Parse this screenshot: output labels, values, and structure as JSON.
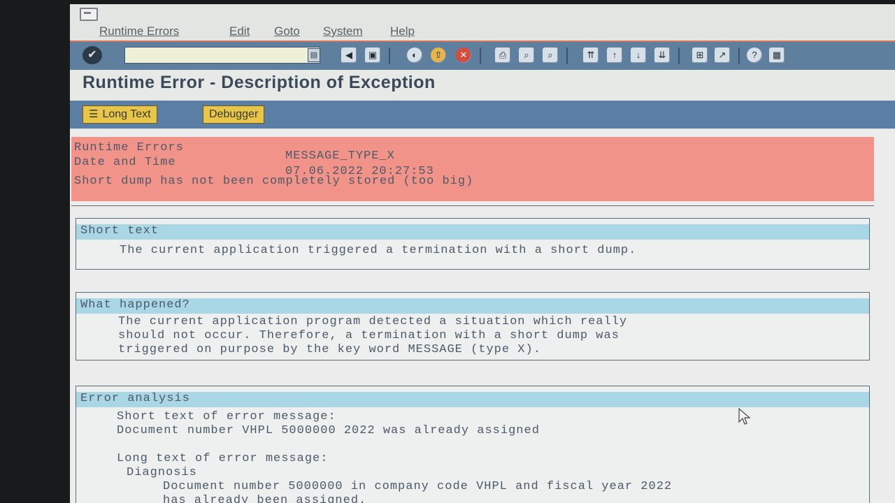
{
  "menu": [
    "Runtime Errors",
    "Edit",
    "Goto",
    "System",
    "Help"
  ],
  "toolbar": {
    "command_value": "",
    "icons": [
      "enter-icon",
      "save-icon",
      "back-icon",
      "exit-icon",
      "cancel-icon",
      "print-icon",
      "find-icon",
      "find-next-icon",
      "first-page-icon",
      "previous-page-icon",
      "next-page-icon",
      "last-page-icon",
      "create-session-icon",
      "shortcut-icon",
      "help-icon",
      "layout-icon"
    ]
  },
  "title": "Runtime Error - Description of Exception",
  "app_toolbar": {
    "long_text": "Long Text",
    "debugger": "Debugger"
  },
  "header": {
    "runtime_errors_label": "Runtime Errors",
    "runtime_errors_value": "MESSAGE_TYPE_X",
    "date_time_label": "Date and Time",
    "date_time_value": "07.06.2022 20:27:53",
    "storage_note": "Short dump has not been completely stored (too big)"
  },
  "short_text": {
    "heading": "Short text",
    "body": "The current application triggered a termination with a short dump."
  },
  "what_happened": {
    "heading": "What happened?",
    "lines": [
      "The current application program detected a situation which really",
      "should not occur. Therefore, a termination with a short dump was",
      "triggered on purpose by the key word MESSAGE (type X)."
    ]
  },
  "error_analysis": {
    "heading": "Error analysis",
    "short_label": "Short text of error message:",
    "short_value": "Document number VHPL 5000000 2022 was already assigned",
    "long_label": "Long text of error message:",
    "diagnosis_label": "Diagnosis",
    "diag_line1": "Document number 5000000 in company code VHPL and fiscal year 2022",
    "diag_line2": "has already been assigned."
  }
}
